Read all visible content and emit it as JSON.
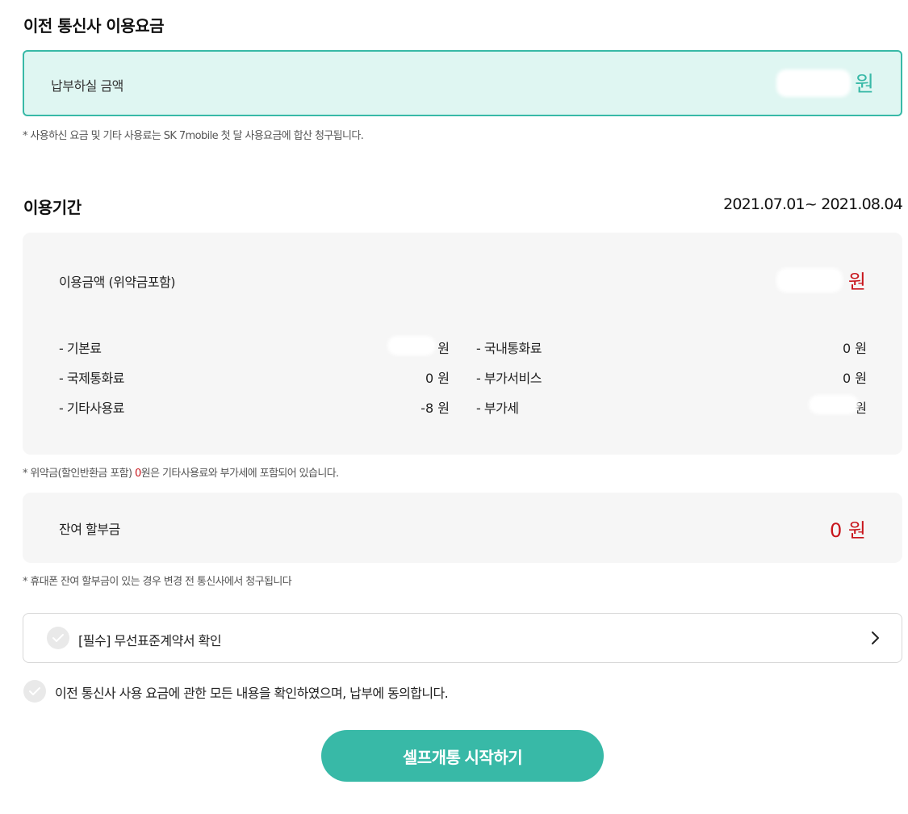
{
  "prev_carrier": {
    "title": "이전 통신사 이용요금",
    "pay_label": "납부하실 금액",
    "pay_unit": "원",
    "note": "* 사용하신 요금 및 기타 사용료는 SK 7mobile 첫 달 사용요금에 합산 청구됩니다."
  },
  "period": {
    "title": "이용기간",
    "value": "2021.07.01~ 2021.08.04"
  },
  "usage": {
    "label": "이용금액 (위약금포함)",
    "unit": "원",
    "fees": [
      {
        "label": "- 기본료",
        "value": "원"
      },
      {
        "label": "- 국내통화료",
        "value": "0 원"
      },
      {
        "label": "- 국제통화료",
        "value": "0 원"
      },
      {
        "label": "- 부가서비스",
        "value": "0 원"
      },
      {
        "label": "- 기타사용료",
        "value": "-8 원"
      },
      {
        "label": "- 부가세",
        "value": "원"
      }
    ],
    "note_prefix": "* 위약금(할인반환금 포함) ",
    "note_amount": "0",
    "note_suffix": "원은 기타사용료와 부가세에 포함되어 있습니다."
  },
  "installment": {
    "label": "잔여 할부금",
    "value": "0 원",
    "note": "* 휴대폰 잔여 할부금이 있는 경우 변경 전 통신사에서 청구됩니다"
  },
  "terms": {
    "label": "[필수] 무선표준계약서 확인"
  },
  "agree": {
    "label": "이전 통신사 사용 요금에 관한 모든 내용을 확인하였으며, 납부에 동의합니다."
  },
  "start_button": "셀프개통 시작하기",
  "colors": {
    "accent": "#38b9a7",
    "accent_bg": "#dff6f2",
    "red": "#c8161d",
    "panel_bg": "#f6f6f6"
  }
}
